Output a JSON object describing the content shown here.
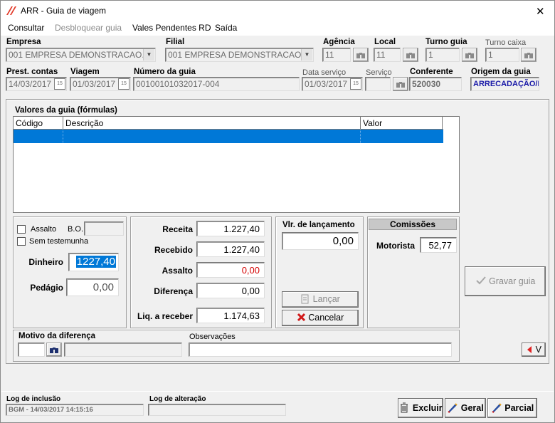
{
  "window": {
    "title": "ARR - Guia de viagem",
    "close_glyph": "✕"
  },
  "menu": [
    {
      "label": "Consultar",
      "enabled": true
    },
    {
      "label": "Desbloquear guia",
      "enabled": false
    },
    {
      "label": "Vales Pendentes RD",
      "enabled": true
    },
    {
      "label": "Saída",
      "enabled": true
    }
  ],
  "header": {
    "empresa_label": "Empresa",
    "empresa_value": "001 EMPRESA DEMONSTRACAO.",
    "filial_label": "Filial",
    "filial_value": "001 EMPRESA DEMONSTRACAO.",
    "agencia_label": "Agência",
    "agencia_value": "11",
    "local_label": "Local",
    "local_value": "11",
    "turno_guia_label": "Turno guia",
    "turno_guia_value": "1",
    "turno_caixa_label": "Turno caixa",
    "turno_caixa_value": "1",
    "prest_label": "Prest. contas",
    "prest_value": "14/03/2017",
    "viagem_label": "Viagem",
    "viagem_value": "01/03/2017",
    "numero_label": "Número da guia",
    "numero_value": "00100101032017-004",
    "data_servico_label": "Data serviço",
    "data_servico_value": "01/03/2017",
    "servico_label": "Serviço",
    "servico_value": "",
    "conferente_label": "Conferente",
    "conferente_value": "520030",
    "origem_label": "Origem da guia",
    "origem_value": "ARRECADAÇÃO/D",
    "cal_glyph": "15"
  },
  "valores": {
    "title": "Valores da guia (fórmulas)",
    "columns": [
      "Código",
      "Descrição",
      "Valor"
    ]
  },
  "left_panel": {
    "assalto_label": "Assalto",
    "bo_label": "B.O.",
    "bo_value": "",
    "sem_testemunha_label": "Sem testemunha",
    "dinheiro_label": "Dinheiro",
    "dinheiro_value": "1227,40",
    "pedagio_label": "Pedágio",
    "pedagio_value": "0,00"
  },
  "totals": {
    "receita_label": "Receita",
    "receita_value": "1.227,40",
    "recebido_label": "Recebido",
    "recebido_value": "1.227,40",
    "assalto_label": "Assalto",
    "assalto_value": "0,00",
    "diferenca_label": "Diferença",
    "diferenca_value": "0,00",
    "liq_label": "Liq. a receber",
    "liq_value": "1.174,63",
    "assalto_color": "#d40000"
  },
  "lancamento": {
    "title": "Vlr. de lançamento",
    "value": "0,00",
    "lancar_label": "Lançar",
    "cancelar_label": "Cancelar"
  },
  "comissoes": {
    "title": "Comissões",
    "motorista_label": "Motorista",
    "motorista_value": "52,77"
  },
  "gravar_label": "Gravar guia",
  "motivo": {
    "label": "Motivo da diferença",
    "code_value": "",
    "desc_value": "",
    "obs_label": "Observações",
    "obs_value": ""
  },
  "v_button_label": "V",
  "log": {
    "inclusao_label": "Log de inclusão",
    "inclusao_value": "BGM - 14/03/2017 14:15:16",
    "alteracao_label": "Log de alteração",
    "alteracao_value": ""
  },
  "footer": {
    "excluir_label": "Excluir",
    "geral_label": "Geral",
    "parcial_label": "Parcial"
  },
  "colors": {
    "accent_selection": "#0078d7",
    "logo_red": "#e23b2a",
    "origem_blue": "#1a1aa8"
  }
}
